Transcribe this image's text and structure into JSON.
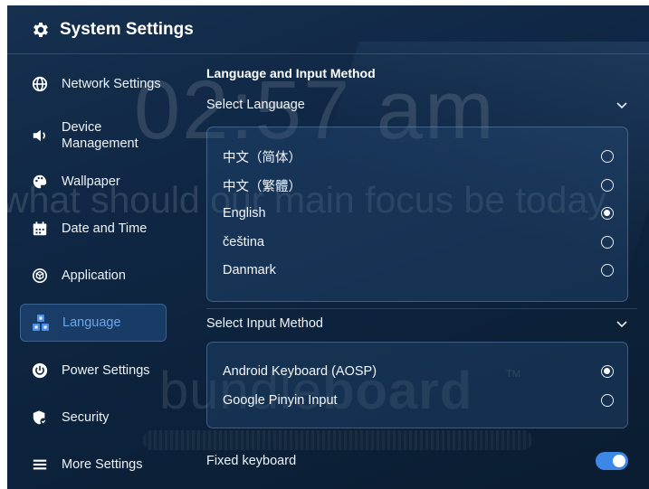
{
  "window": {
    "title": "System Settings"
  },
  "background": {
    "clock": "02:57 am",
    "focus_prompt": "what should our main focus be today",
    "brand_light": "bundle",
    "brand_bold": "board",
    "trademark": "TM"
  },
  "sidebar": {
    "items": [
      {
        "label": "Network Settings",
        "icon": "globe-icon"
      },
      {
        "label": "Device Management",
        "icon": "speaker-icon"
      },
      {
        "label": "Wallpaper",
        "icon": "palette-icon"
      },
      {
        "label": "Date and Time",
        "icon": "calendar-icon"
      },
      {
        "label": "Application",
        "icon": "cube-icon"
      },
      {
        "label": "Language",
        "icon": "language-blocks-icon",
        "active": true
      },
      {
        "label": "Power Settings",
        "icon": "power-icon"
      },
      {
        "label": "Security",
        "icon": "shield-icon"
      },
      {
        "label": "More Settings",
        "icon": "menu-icon"
      }
    ]
  },
  "main": {
    "section_title": "Language and Input Method",
    "language": {
      "label": "Select Language",
      "options": [
        {
          "label": "中文（简体）",
          "selected": false
        },
        {
          "label": "中文（繁體）",
          "selected": false
        },
        {
          "label": "English",
          "selected": true
        },
        {
          "label": "čeština",
          "selected": false
        },
        {
          "label": "Danmark",
          "selected": false
        }
      ]
    },
    "input_method": {
      "label": "Select Input Method",
      "options": [
        {
          "label": "Android Keyboard (AOSP)",
          "selected": true
        },
        {
          "label": "Google Pinyin Input",
          "selected": false
        }
      ]
    },
    "fixed_keyboard": {
      "label": "Fixed keyboard",
      "enabled": true
    }
  },
  "colors": {
    "accent": "#3d87e8",
    "active_text": "#6ea6ec",
    "background": "#0f2744"
  }
}
